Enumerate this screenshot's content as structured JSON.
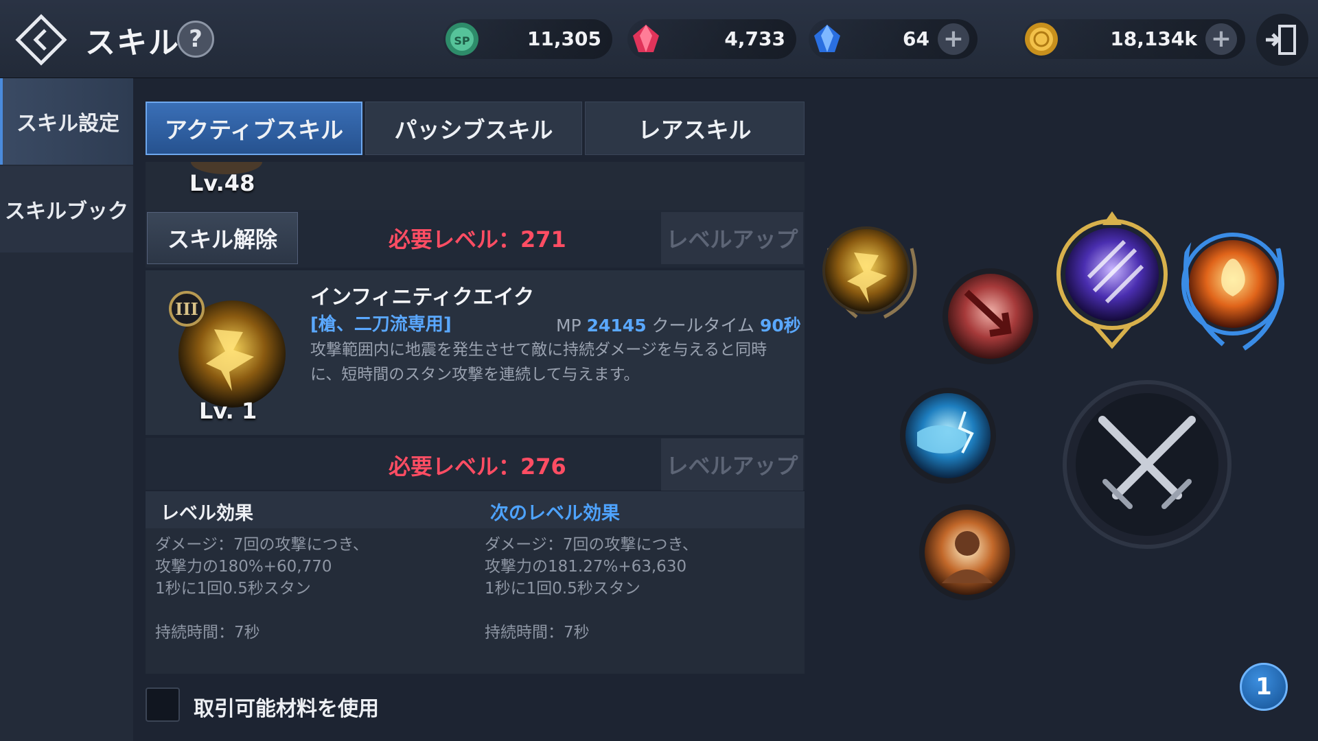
{
  "header": {
    "title": "スキル",
    "help_label": "?",
    "back_icon": "back-diamond-icon",
    "exit_icon": "exit-door-icon"
  },
  "currencies": [
    {
      "name": "sp-coin-icon",
      "value": "11,305"
    },
    {
      "name": "red-gem-icon",
      "value": "4,733"
    },
    {
      "name": "blue-gem-icon",
      "value": "64"
    },
    {
      "name": "gold-coin-icon",
      "value": "18,134k"
    }
  ],
  "plus_label": "+",
  "sidenav": {
    "items": [
      {
        "label": "スキル設定",
        "active": true
      },
      {
        "label": "スキルブック",
        "active": false
      }
    ]
  },
  "tabs": [
    {
      "label": "アクティブスキル",
      "active": true
    },
    {
      "label": "パッシブスキル",
      "active": false
    },
    {
      "label": "レアスキル",
      "active": false
    }
  ],
  "prev_skill": {
    "level": "Lv.48",
    "release_label": "スキル解除",
    "req_label": "必要レベル：",
    "req_value": "271",
    "levelup_label": "レベルアップ"
  },
  "skill": {
    "tier": "III",
    "name": "インフィニティクエイク",
    "weapon": "[槍、二刀流専用]",
    "mp_label": "MP",
    "mp_value": "24145",
    "cooldown_label": "クールタイム",
    "cooldown_value": "90秒",
    "desc_line1": "攻撃範囲内に地震を発生させて敵に持続ダメージを与えると同時",
    "desc_line2": "に、短時間のスタン攻撃を連続して与えます。",
    "level": "Lv. 1",
    "req_label": "必要レベル：",
    "req_value": "276",
    "levelup_label": "レベルアップ"
  },
  "effects": {
    "current_title": "レベル効果",
    "next_title": "次のレベル効果",
    "current": [
      "ダメージ：7回の攻撃につき、",
      "攻撃力の180%+60,770",
      "1秒に1回0.5秒スタン",
      "持続時間：7秒"
    ],
    "next": [
      "ダメージ：7回の攻撃につき、",
      "攻撃力の181.27%+63,630",
      "1秒に1回0.5秒スタン",
      "持続時間：7秒"
    ]
  },
  "tradeable_label": "取引可能材料を使用",
  "page_badge": "1",
  "colors": {
    "accent_blue": "#5aa8ff",
    "req_red": "#ff4d63",
    "tab_active": "#3a6fb7"
  }
}
